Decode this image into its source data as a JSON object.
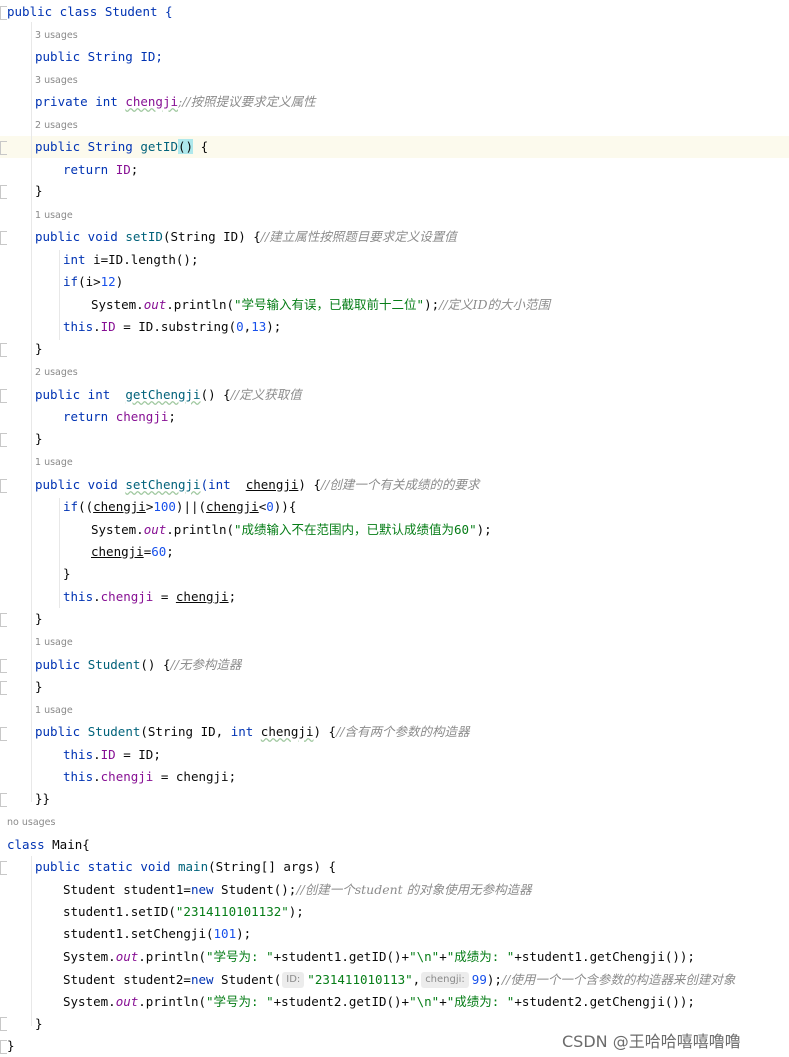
{
  "code": {
    "l1": "public class Student {",
    "h_id": "3 usages",
    "l_id": "public String ID;",
    "h_cj": "3 usages",
    "l_cj_kw": "private int ",
    "l_cj_name": "chengji",
    "l_cj_cmt": ";//按照提议要求定义属性",
    "h_get": "2 usages",
    "get_sig_a": "public String ",
    "get_sig_m": "getID",
    "get_sig_p": "(",
    "get_sig_p2": ")",
    "get_sig_b": " {",
    "ret_kw": "return ",
    "ret_val": "ID",
    "ret_end": ";",
    "close": "}",
    "h_set": "1 usage",
    "set_a": "public void ",
    "set_m": "setID",
    "set_b": "(String ID) {",
    "set_cmt": "//建立属性按照题目要求定义设置值",
    "set_l1_kw": "int ",
    "set_l1": "i=ID.length();",
    "set_l2_kw": "if",
    "set_l2a": "(i>",
    "set_l2n": "12",
    "set_l2b": ")",
    "set_l3a": "System.",
    "set_l3o": "out",
    "set_l3b": ".println(",
    "set_l3s": "\"学号输入有误，已截取前十二位\"",
    "set_l3c": ");",
    "set_l3cmt": "//定义ID的大小范围",
    "set_l4_kw": "this",
    "set_l4a": ".",
    "set_l4f": "ID",
    "set_l4b": " = ID.substring(",
    "set_l4n1": "0",
    "set_l4c": ",",
    "set_l4n2": "13",
    "set_l4d": ");",
    "h_gc": "2 usages",
    "gc_a": "public int  ",
    "gc_m": "getChengji",
    "gc_b": "() {",
    "gc_cmt": "//定义获取值",
    "gc_ret": "return ",
    "gc_val": "chengji",
    "gc_end": ";",
    "h_sc": "1 usage",
    "sc_a": "public void ",
    "sc_m": "setChengji",
    "sc_b": "(int  ",
    "sc_p": "chengji",
    "sc_c": ") {",
    "sc_cmt": "//创建一个有关成绩的的要求",
    "sc_l1_kw": "if",
    "sc_l1a": "((",
    "sc_l1v1": "chengji",
    "sc_l1b": ">",
    "sc_l1n1": "100",
    "sc_l1c": ")||(",
    "sc_l1v2": "chengji",
    "sc_l1d": "<",
    "sc_l1n2": "0",
    "sc_l1e": ")){",
    "sc_l2a": "System.",
    "sc_l2o": "out",
    "sc_l2b": ".println(",
    "sc_l2s": "\"成绩输入不在范围内，已默认成绩值为60\"",
    "sc_l2c": ");",
    "sc_l3v": "chengji",
    "sc_l3a": "=",
    "sc_l3n": "60",
    "sc_l3b": ";",
    "sc_l5_kw": "this",
    "sc_l5a": ".",
    "sc_l5f": "chengji",
    "sc_l5b": " = ",
    "sc_l5v": "chengji",
    "sc_l5c": ";",
    "h_c1": "1 usage",
    "c1_a": "public ",
    "c1_m": "Student",
    "c1_b": "() {",
    "c1_cmt": "//无参构造器",
    "h_c2": "1 usage",
    "c2_a": "public ",
    "c2_m": "Student",
    "c2_b": "(String ID, ",
    "c2_kw": "int ",
    "c2_p": "chengji",
    "c2_c": ") {",
    "c2_cmt": "//含有两个参数的构造器",
    "c2_l1_kw": "this",
    "c2_l1a": ".",
    "c2_l1f": "ID",
    "c2_l1b": " = ID;",
    "c2_l2_kw": "this",
    "c2_l2a": ".",
    "c2_l2f": "chengji",
    "c2_l2b": " = chengji;",
    "class_close": "}}",
    "h_main": "no usages",
    "main_cls_kw": "class ",
    "main_cls": "Main{",
    "main_sig_a": "public static void ",
    "main_sig_m": "main",
    "main_sig_b": "(String[] args) {",
    "m1a": "Student student1=",
    "m1kw": "new ",
    "m1b": "Student();",
    "m1cmt": "//创建一个student 的对象使用无参构造器",
    "m2a": "student1.setID(",
    "m2s": "\"2314110101132\"",
    "m2b": ");",
    "m3a": "student1.setChengji(",
    "m3n": "101",
    "m3b": ");",
    "m4a": "System.",
    "m4o": "out",
    "m4b": ".println(",
    "m4s1": "\"学号为: \"",
    "m4c": "+student1.getID()+",
    "m4s2": "\"\\n\"",
    "m4d": "+",
    "m4s3": "\"成绩为: \"",
    "m4e": "+student1.getChengji());",
    "m5a": "Student student2=",
    "m5kw": "new ",
    "m5b": "Student(",
    "m5hint1": "ID:",
    "m5s": "\"231411010113\"",
    "m5c": ",",
    "m5hint2": "chengji:",
    "m5n": "99",
    "m5d": ");",
    "m5cmt": "//使用一个一个含参数的构造器来创建对象",
    "m6a": "System.",
    "m6o": "out",
    "m6b": ".println(",
    "m6s1": "\"学号为: \"",
    "m6c": "+student2.getID()+",
    "m6s2": "\"\\n\"",
    "m6d": "+",
    "m6s3": "\"成绩为: \"",
    "m6e": "+student2.getChengji());",
    "main_close_inner": "}",
    "main_close": "}"
  },
  "watermark": "CSDN @王哈哈嘻嘻噜噜",
  "colors": {
    "keyword": "#0033b3",
    "field": "#871094",
    "number": "#1750eb",
    "string": "#067d17",
    "comment": "#8c8c8c",
    "method": "#00627a",
    "caret_highlight": "#aee8ec",
    "current_line": "#fcfaed"
  }
}
